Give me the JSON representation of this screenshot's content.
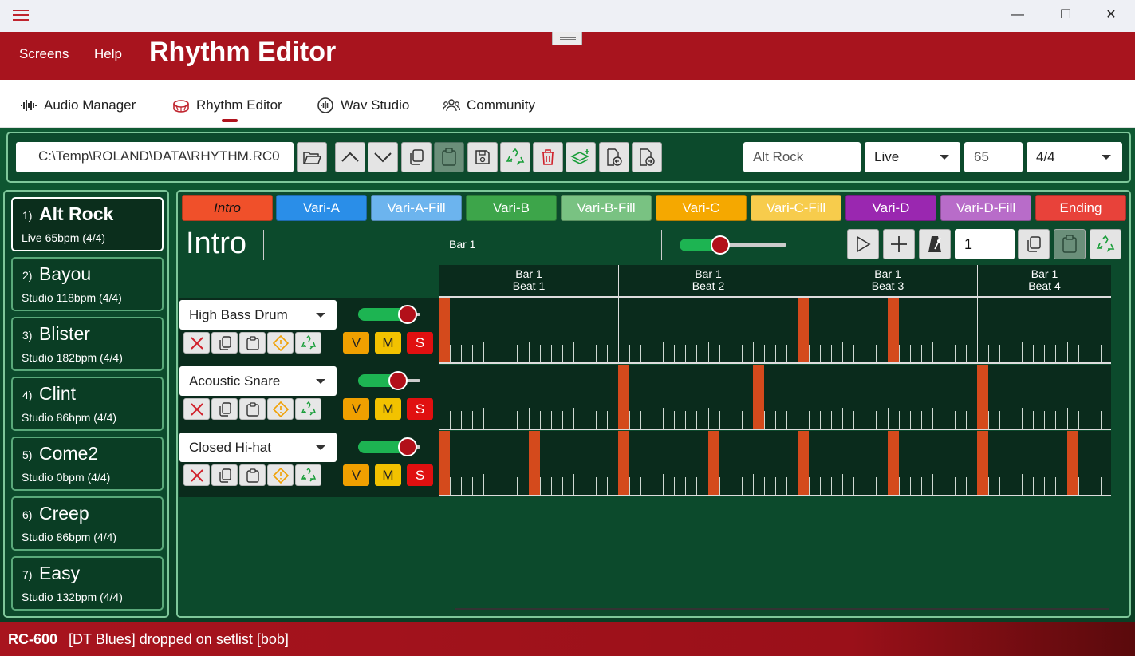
{
  "window": {
    "minimize": "—",
    "maximize": "☐",
    "close": "✕"
  },
  "header": {
    "menu": [
      "Screens",
      "Help"
    ],
    "title": "Rhythm Editor"
  },
  "nav": {
    "items": [
      {
        "label": "Audio Manager",
        "icon": "waveform-icon"
      },
      {
        "label": "Rhythm Editor",
        "icon": "drum-icon",
        "active": true
      },
      {
        "label": "Wav Studio",
        "icon": "wav-studio-icon"
      },
      {
        "label": "Community",
        "icon": "people-icon"
      }
    ]
  },
  "toolbar": {
    "path": "C:\\Temp\\ROLAND\\DATA\\RHYTHM.RC0",
    "rhythm_name": "Alt Rock",
    "mode": "Live",
    "tempo": "65",
    "time_signature": "4/4"
  },
  "setlist": [
    {
      "num": "1)",
      "name": "Alt Rock",
      "sub": "Live 65bpm (4/4)",
      "selected": true
    },
    {
      "num": "2)",
      "name": "Bayou",
      "sub": "Studio 118bpm (4/4)"
    },
    {
      "num": "3)",
      "name": "Blister",
      "sub": "Studio 182bpm (4/4)"
    },
    {
      "num": "4)",
      "name": "Clint",
      "sub": "Studio 86bpm (4/4)"
    },
    {
      "num": "5)",
      "name": "Come2",
      "sub": "Studio 0bpm (4/4)"
    },
    {
      "num": "6)",
      "name": "Creep",
      "sub": "Studio 86bpm (4/4)"
    },
    {
      "num": "7)",
      "name": "Easy",
      "sub": "Studio 132bpm (4/4)"
    }
  ],
  "tabs": [
    {
      "label": "Intro",
      "color": "#f0502a",
      "active": true
    },
    {
      "label": "Vari-A",
      "color": "#2a8ee8"
    },
    {
      "label": "Vari-A-Fill",
      "color": "#6cb4ee"
    },
    {
      "label": "Vari-B",
      "color": "#3da54a"
    },
    {
      "label": "Vari-B-Fill",
      "color": "#79c282"
    },
    {
      "label": "Vari-C",
      "color": "#f5a800"
    },
    {
      "label": "Vari-C-Fill",
      "color": "#f7cc4c"
    },
    {
      "label": "Vari-D",
      "color": "#9a27b0"
    },
    {
      "label": "Vari-D-Fill",
      "color": "#b86cc9"
    },
    {
      "label": "Ending",
      "color": "#e8423a"
    }
  ],
  "pattern": {
    "title": "Intro",
    "bar_label": "Bar 1",
    "bar_number": "1",
    "volume": 0.38
  },
  "beats": [
    {
      "bar": "Bar 1",
      "beat": "Beat 1"
    },
    {
      "bar": "Bar 1",
      "beat": "Beat 2"
    },
    {
      "bar": "Bar 1",
      "beat": "Beat 3"
    },
    {
      "bar": "Bar 1",
      "beat": "Beat 4"
    }
  ],
  "tracks": [
    {
      "instrument": "High Bass Drum",
      "volume": 0.8,
      "hits": [
        0,
        32,
        40
      ]
    },
    {
      "instrument": "Acoustic Snare",
      "volume": 0.64,
      "hits": [
        16,
        28,
        48
      ]
    },
    {
      "instrument": "Closed Hi-hat",
      "volume": 0.8,
      "hits": [
        0,
        8,
        16,
        24,
        32,
        40,
        48,
        56
      ]
    }
  ],
  "track_buttons": {
    "v": "V",
    "m": "M",
    "s": "S"
  },
  "status": {
    "device": "RC-600",
    "message": "[DT Blues] dropped on setlist [bob]"
  },
  "accent": "#a8141e"
}
